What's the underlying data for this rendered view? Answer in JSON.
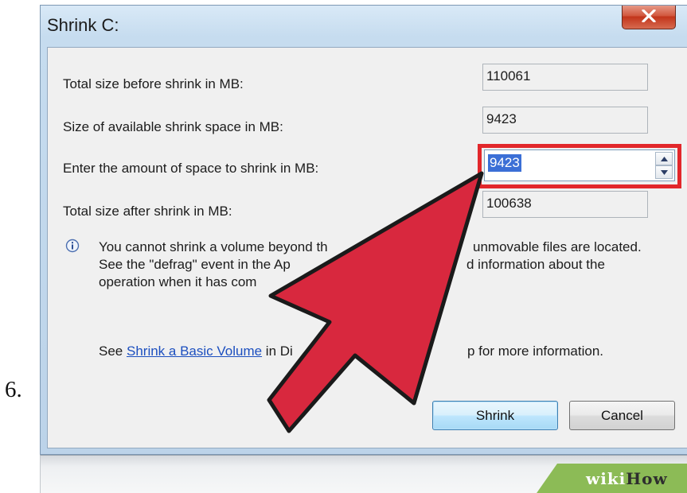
{
  "step": {
    "number": "6."
  },
  "dialog": {
    "title": "Shrink C:",
    "rows": [
      {
        "label": "Total size before shrink in MB:",
        "value": "110061"
      },
      {
        "label": "Size of available shrink space in MB:",
        "value": "9423"
      },
      {
        "label": "Enter the amount of space to shrink in MB:",
        "value": "9423"
      },
      {
        "label": "Total size after shrink in MB:",
        "value": "100638"
      }
    ],
    "info": {
      "line1": "You cannot shrink a volume beyond th",
      "line1_end": "unmovable files are located.",
      "line2": "See the \"defrag\" event in the Ap",
      "line2_end": "d information about the",
      "line3": "operation when it has com"
    },
    "see": {
      "prefix": "See ",
      "link": "Shrink a Basic Volume",
      "middle": " in Di",
      "suffix": "p for more information."
    },
    "buttons": {
      "shrink": "Shrink",
      "cancel": "Cancel"
    }
  },
  "watermark": {
    "part1": "wiki",
    "part2": "How"
  },
  "colors": {
    "highlight": "#e2272b",
    "arrow": "#d8283e",
    "link": "#1c4fbf",
    "selection": "#3b6fd6"
  }
}
